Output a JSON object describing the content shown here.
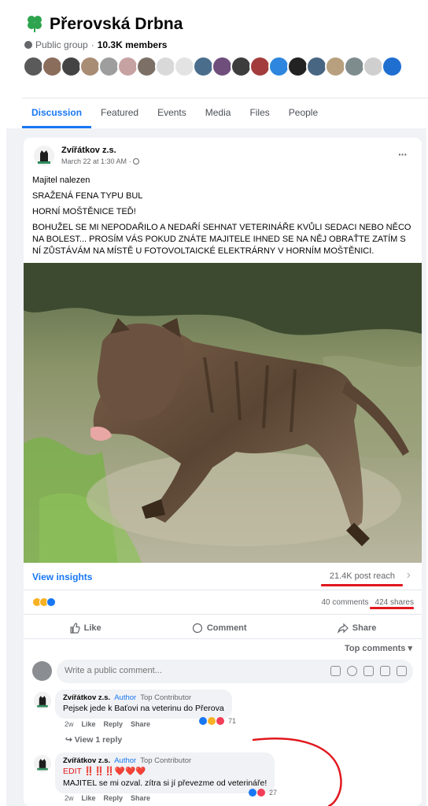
{
  "group": {
    "name": "Přerovská Drbna",
    "privacy": "Public group",
    "members": "10.3K members"
  },
  "tabs": [
    "Discussion",
    "Featured",
    "Events",
    "Media",
    "Files",
    "People"
  ],
  "post": {
    "author": "Zvířátkov z.s.",
    "time": "March 22 at 1:30 AM",
    "more": "···",
    "lines": [
      "Majitel nalezen",
      "SRAŽENÁ FENA TYPU BUL",
      "HORNÍ MOŠTĚNICE TEĎ!",
      "BOHUŽEL SE MI NEPODAŘILO A NEDAŘÍ SEHNAT VETERINÁŘE KVŮLI SEDACI NEBO NĚCO NA BOLEST... PROSÍM VÁS POKUD ZNÁTE MAJITELE IHNED SE NA NĚJ OBRAŤTE ZATÍM S NÍ ZŮSTÁVÁM NA MÍSTĚ U FOTOVOLTAICKÉ ELEKTRÁRNY V HORNÍM MOŠTĚNICI."
    ],
    "insights_label": "View insights",
    "reach": "21.4K post reach",
    "comments_count": "40 comments",
    "shares_count": "424 shares",
    "actions": {
      "like": "Like",
      "comment": "Comment",
      "share": "Share"
    },
    "sort_label": "Top comments ▾",
    "compose_placeholder": "Write a public comment..."
  },
  "comments": [
    {
      "name": "Zvířátkov z.s.",
      "badge": "Author",
      "role": "Top Contributor",
      "lines": [
        "Pejsek jede k Baťovi na veterinu do Přerova"
      ],
      "time": "2w",
      "like": "Like",
      "reply": "Reply",
      "share": "Share",
      "react_count": "71",
      "view_replies": "↪ View 1 reply"
    },
    {
      "name": "Zvířátkov z.s.",
      "badge": "Author",
      "role": "Top Contributor",
      "lines": [
        "EDIT ‼️‼️‼️❤️❤️❤️",
        "MAJITEL se mi ozval. zítra si jí převezme od veterináře!"
      ],
      "time": "2w",
      "like": "Like",
      "reply": "Reply",
      "share": "Share",
      "react_count": "27"
    }
  ],
  "colors": {
    "accent": "#1877f2",
    "annotation": "#e0181e",
    "clover": "#2ea44f"
  }
}
